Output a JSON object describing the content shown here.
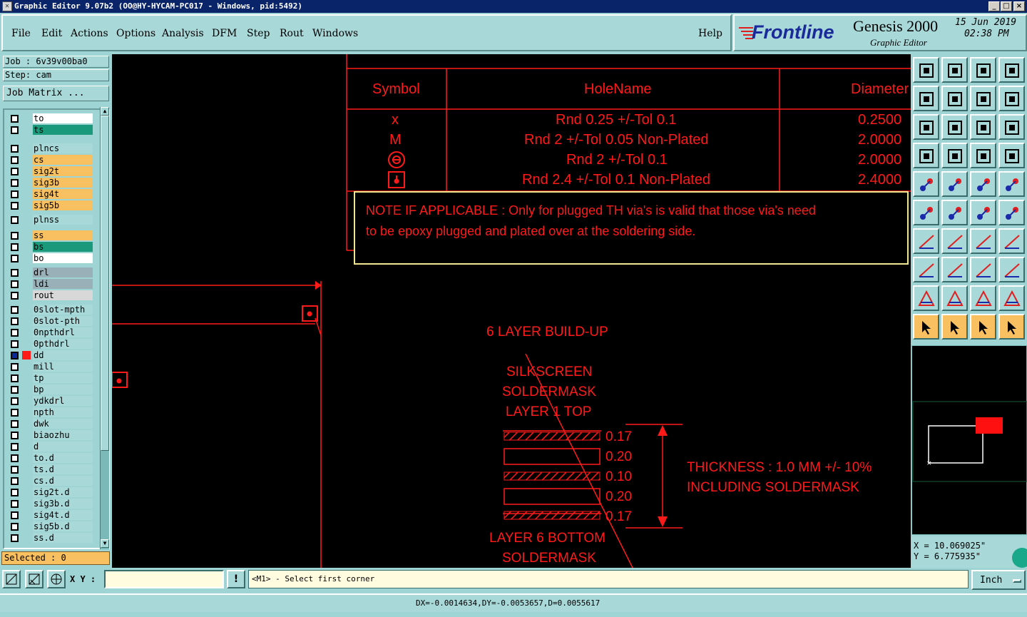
{
  "window": {
    "title": "Graphic Editor 9.07b2 (OO@HY-HYCAM-PC017 - Windows, pid:5492)",
    "icon": "app-icon"
  },
  "menu": [
    "File",
    "Edit",
    "Actions",
    "Options",
    "Analysis",
    "DFM",
    "Step",
    "Rout",
    "Windows"
  ],
  "help": "Help",
  "brand": {
    "logo": "Frontline",
    "product": "Genesis 2000",
    "subtitle": "Graphic Editor",
    "date": "15 Jun 2019",
    "time": "02:38 PM"
  },
  "job": {
    "job_label": "Job : 6v39v00ba0",
    "step_label": "Step: cam",
    "matrix_button": "Job Matrix ..."
  },
  "layers": [
    {
      "name": "to",
      "color": "#ffffff"
    },
    {
      "name": "ts",
      "color": "#1a9a7a"
    },
    {
      "name": "plncs",
      "color": "#a8d8d8"
    },
    {
      "name": "cs",
      "color": "#f8c060"
    },
    {
      "name": "sig2t",
      "color": "#f8c060"
    },
    {
      "name": "sig3b",
      "color": "#f8c060"
    },
    {
      "name": "sig4t",
      "color": "#f8c060"
    },
    {
      "name": "sig5b",
      "color": "#f8c060"
    },
    {
      "name": "plnss",
      "color": "#a8d8d8"
    },
    {
      "name": "ss",
      "color": "#f8c060"
    },
    {
      "name": "bs",
      "color": "#1a9a7a"
    },
    {
      "name": "bo",
      "color": "#ffffff"
    },
    {
      "name": "drl",
      "color": "#9ab0b8"
    },
    {
      "name": "ldi",
      "color": "#9ab0b8"
    },
    {
      "name": "rout",
      "color": "#d8d8d8"
    },
    {
      "name": "0slot-mpth",
      "color": "#a8d8d8"
    },
    {
      "name": "0slot-pth",
      "color": "#a8d8d8"
    },
    {
      "name": "0npthdrl",
      "color": "#a8d8d8"
    },
    {
      "name": "0pthdrl",
      "color": "#a8d8d8"
    },
    {
      "name": "dd",
      "color": "#a8d8d8"
    },
    {
      "name": "mill",
      "color": "#a8d8d8"
    },
    {
      "name": "tp",
      "color": "#a8d8d8"
    },
    {
      "name": "bp",
      "color": "#a8d8d8"
    },
    {
      "name": "ydkdrl",
      "color": "#a8d8d8"
    },
    {
      "name": "npth",
      "color": "#a8d8d8"
    },
    {
      "name": "dwk",
      "color": "#a8d8d8"
    },
    {
      "name": "biaozhu",
      "color": "#a8d8d8"
    },
    {
      "name": "d",
      "color": "#a8d8d8"
    },
    {
      "name": "to.d",
      "color": "#a8d8d8"
    },
    {
      "name": "ts.d",
      "color": "#a8d8d8"
    },
    {
      "name": "cs.d",
      "color": "#a8d8d8"
    },
    {
      "name": "sig2t.d",
      "color": "#a8d8d8"
    },
    {
      "name": "sig3b.d",
      "color": "#a8d8d8"
    },
    {
      "name": "sig4t.d",
      "color": "#a8d8d8"
    },
    {
      "name": "sig5b.d",
      "color": "#a8d8d8"
    },
    {
      "name": "ss.d",
      "color": "#a8d8d8"
    }
  ],
  "selected": "Selected : 0",
  "drawing": {
    "table_headers": [
      "Symbol",
      "HoleName",
      "Diameter"
    ],
    "rows": [
      {
        "symbol": "x",
        "hole": "Rnd 0.25 +/-Tol 0.1",
        "diameter": "0.2500"
      },
      {
        "symbol": "M",
        "hole": "Rnd 2 +/-Tol 0.05 Non-Plated",
        "diameter": "2.0000"
      },
      {
        "symbol": "circle-symbol",
        "hole": "Rnd 2 +/-Tol 0.1",
        "diameter": "2.0000"
      },
      {
        "symbol": "square-symbol",
        "hole": "Rnd 2.4 +/-Tol 0.1 Non-Plated",
        "diameter": "2.4000"
      }
    ],
    "note_line1": "NOTE IF APPLICABLE : Only for plugged TH via's is valid that those via's need",
    "note_line2": "to be epoxy plugged and plated over at the soldering side.",
    "buildup_title": "6 LAYER BUILD-UP",
    "top_labels": [
      "SILKSCREEN",
      "SOLDERMASK",
      "LAYER 1 TOP"
    ],
    "thicknesses": [
      "0.17",
      "0.20",
      "0.10",
      "0.20",
      "0.17"
    ],
    "bottom_labels": [
      "LAYER 6 BOTTOM",
      "SOLDERMASK"
    ],
    "thickness_line1": "THICKNESS : 1.0 MM +/- 10%",
    "thickness_line2": "INCLUDING SOLDERMASK"
  },
  "coords": {
    "x": "X  = 10.069025\"",
    "y": "Y  = 6.775935\""
  },
  "bottom": {
    "xy_label": "X Y :",
    "xy_value": "",
    "prompt": "<M1> - Select first corner",
    "units": "Inch"
  },
  "status": "DX=-0.0014634,DY=-0.0053657,D=0.0055617",
  "colors": {
    "red": "#ff1a1a",
    "teal": "#a8d8d8",
    "note_border": "#f0e68c"
  }
}
